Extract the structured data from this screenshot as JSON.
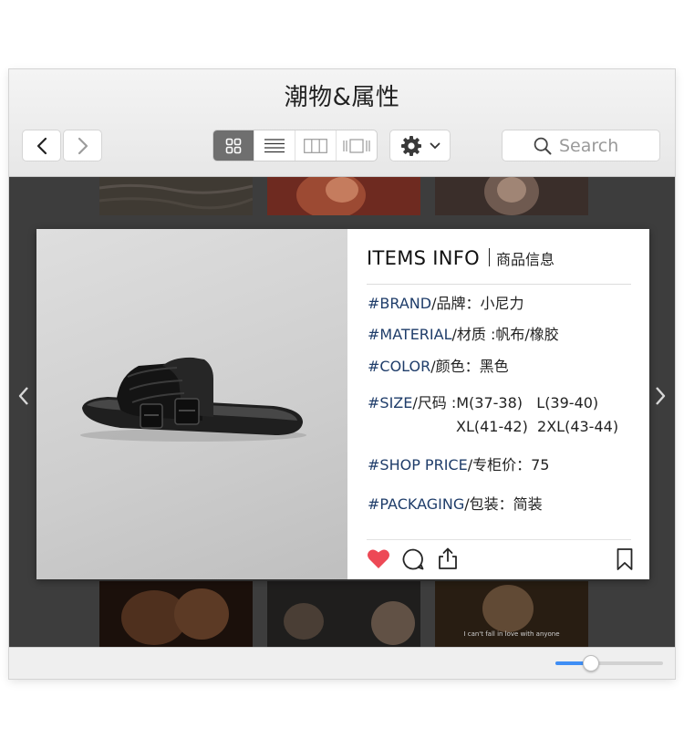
{
  "window": {
    "title": "潮物&属性"
  },
  "toolbar": {
    "back_icon": "chevron-left-icon",
    "forward_icon": "chevron-right-icon",
    "views": [
      "grid-icon",
      "list-icon",
      "columns-icon",
      "coverflow-icon"
    ],
    "active_view": "grid-icon",
    "settings_icon": "gear-icon",
    "search_placeholder": "Search"
  },
  "card": {
    "head_en": "ITEMS INFO",
    "head_cn": "商品信息",
    "brand_tag": "#BRAND",
    "brand_label": "/品牌：",
    "brand_value": "小尼力",
    "material_tag": "#MATERIAL",
    "material_label": "/材质 :",
    "material_value": "帆布/橡胶",
    "color_tag": "#COLOR",
    "color_label": "/颜色：",
    "color_value": "黑色",
    "size_tag": "#SIZE",
    "size_label": "/尺码 :",
    "size_line1": "M(37-38)   L(39-40)",
    "size_line2": "XL(41-42)  2XL(43-44)",
    "price_tag": "#SHOP PRICE",
    "price_label": "/专柜价：",
    "price_value": "75",
    "packaging_tag": "#PACKAGING",
    "packaging_label": "/包装：",
    "packaging_value": "简装",
    "like_color": "#ed4956",
    "tag_color": "#1f3d6a"
  },
  "gallery": {
    "subtitle_fragment": "I can't fall in love with anyone"
  },
  "zoom": {
    "level": 0.32,
    "accent": "#3f8ef5"
  }
}
